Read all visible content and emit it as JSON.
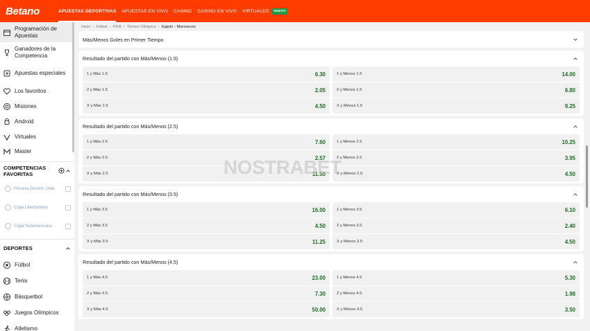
{
  "brand": {
    "logo": "Betano",
    "accent": "#ff3c00",
    "odds_color": "#1b6e26",
    "badge_color": "#1e9a49"
  },
  "topnav": {
    "items": [
      {
        "label": "APUESTAS DEPORTIVAS",
        "active": true
      },
      {
        "label": "APUESTAS EN VIVO"
      },
      {
        "label": "CASINO"
      },
      {
        "label": "CASINO EN VIVO"
      },
      {
        "label": "VIRTUALES"
      }
    ],
    "badge": "NUEVO"
  },
  "sidebar": {
    "items": [
      {
        "label": "Programación de Apuestas",
        "icon": "calendar-icon"
      },
      {
        "label": "Ganadores de la Competencia",
        "icon": "trophy-icon"
      },
      {
        "label": "Apuestas especiales",
        "icon": "special-bets-icon"
      },
      {
        "label": "Los favoritos",
        "icon": "heart-icon"
      },
      {
        "label": "Misiones",
        "icon": "target-icon"
      },
      {
        "label": "Android",
        "icon": "android-icon"
      },
      {
        "label": "Virtuales",
        "icon": "virtual-icon"
      },
      {
        "label": "Master",
        "icon": "master-icon"
      }
    ],
    "fav_title": "COMPETENCIAS FAVORITAS",
    "favorites": [
      {
        "label": "Primera División Chile"
      },
      {
        "label": "Copa Libertadores"
      },
      {
        "label": "Copa Sudamericana"
      }
    ],
    "sports_title": "DEPORTES",
    "sports": [
      {
        "label": "Fútbol",
        "icon": "soccer-icon"
      },
      {
        "label": "Tenis",
        "icon": "tennis-icon"
      },
      {
        "label": "Básquetbol",
        "icon": "basketball-icon"
      },
      {
        "label": "Juegos Olímpicos",
        "icon": "olympics-icon"
      },
      {
        "label": "Atletismo",
        "icon": "athletics-icon"
      }
    ]
  },
  "breadcrumb": [
    "Inicio",
    "Fútbol",
    "FIFA",
    "Torneo Olímpico",
    "Egipto - Marruecos"
  ],
  "collapsed_market": "Más/Menos Goles en Primer Tiempo",
  "markets": [
    {
      "title": "Resultado del partido con Más/Menos (1.5)",
      "rows": [
        [
          {
            "sel": "1 y Más 1.5",
            "odd": "6.30"
          },
          {
            "sel": "1 y Menos 1.5",
            "odd": "14.00"
          }
        ],
        [
          {
            "sel": "2 y Más 1.5",
            "odd": "2.05"
          },
          {
            "sel": "2 y Menos 1.5",
            "odd": "6.80"
          }
        ],
        [
          {
            "sel": "X y Más 1.5",
            "odd": "4.50"
          },
          {
            "sel": "X y Menos 1.5",
            "odd": "9.25"
          }
        ]
      ]
    },
    {
      "title": "Resultado del partido con Más/Menos (2.5)",
      "rows": [
        [
          {
            "sel": "1 y Más 2.5",
            "odd": "7.60"
          },
          {
            "sel": "1 y Menos 2.5",
            "odd": "10.25"
          }
        ],
        [
          {
            "sel": "2 y Más 2.5",
            "odd": "2.57"
          },
          {
            "sel": "2 y Menos 2.5",
            "odd": "3.95"
          }
        ],
        [
          {
            "sel": "X y Más 2.5",
            "odd": "11.50"
          },
          {
            "sel": "X y Menos 2.5",
            "odd": "4.50"
          }
        ]
      ]
    },
    {
      "title": "Resultado del partido con Más/Menos (3.5)",
      "rows": [
        [
          {
            "sel": "1 y Más 3.5",
            "odd": "16.00"
          },
          {
            "sel": "1 y Menos 3.5",
            "odd": "6.10"
          }
        ],
        [
          {
            "sel": "2 y Más 3.5",
            "odd": "4.50"
          },
          {
            "sel": "2 y Menos 3.5",
            "odd": "2.40"
          }
        ],
        [
          {
            "sel": "X y Más 3.5",
            "odd": "11.25"
          },
          {
            "sel": "X y Menos 3.5",
            "odd": "4.50"
          }
        ]
      ]
    },
    {
      "title": "Resultado del partido con Más/Menos (4.5)",
      "rows": [
        [
          {
            "sel": "1 y Más 4.5",
            "odd": "23.00"
          },
          {
            "sel": "1 y Menos 4.5",
            "odd": "5.30"
          }
        ],
        [
          {
            "sel": "2 y Más 4.5",
            "odd": "7.30"
          },
          {
            "sel": "2 y Menos 4.5",
            "odd": "1.98"
          }
        ],
        [
          {
            "sel": "X y Más 4.5",
            "odd": "50.00"
          },
          {
            "sel": "X y Menos 4.5",
            "odd": "3.50"
          }
        ]
      ]
    }
  ],
  "watermark": "NOSTRABET"
}
